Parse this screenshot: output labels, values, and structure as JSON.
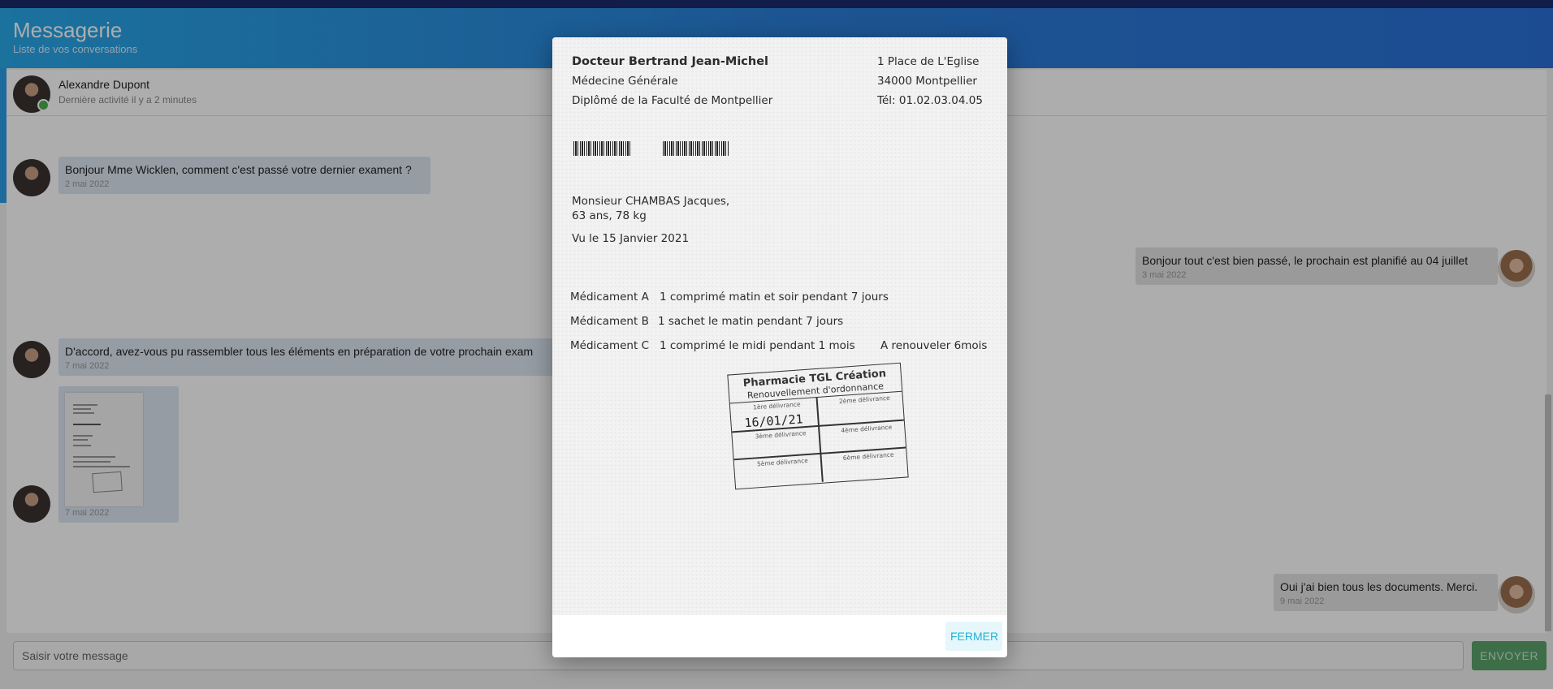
{
  "header": {
    "title": "Messagerie",
    "subtitle": "Liste de vos conversations"
  },
  "conversation": {
    "contact_name": "Alexandre Dupont",
    "status": "Dernière activité il y a 2 minutes"
  },
  "messages": [
    {
      "direction": "in",
      "text": "Bonjour Mme Wicklen, comment c'est passé votre dernier exament ?",
      "date": "2 mai 2022"
    },
    {
      "direction": "out",
      "text": "Bonjour tout c'est bien passé, le prochain est planifié au 04 juillet",
      "date": "3 mai 2022"
    },
    {
      "direction": "in",
      "text": "D'accord, avez-vous pu rassembler tous les éléments en préparation de votre prochain exam",
      "date": "7 mai 2022"
    },
    {
      "direction": "in",
      "attachment": "prescription-thumbnail",
      "date": "7 mai 2022"
    },
    {
      "direction": "out",
      "text": "Oui j'ai bien tous les documents. Merci.",
      "date": "9 mai 2022"
    }
  ],
  "composer": {
    "placeholder": "Saisir votre message",
    "send_label": "ENVOYER"
  },
  "modal": {
    "close_label": "FERMER",
    "prescription": {
      "doctor": "Docteur Bertrand Jean-Michel",
      "specialty": "Médecine Générale",
      "diploma": "Diplômé de la Faculté de Montpellier",
      "address1": "1 Place de L'Eglise",
      "address2": "34000 Montpellier",
      "phone": "Tél: 01.02.03.04.05",
      "patient_name": "Monsieur CHAMBAS Jacques,",
      "patient_info": "63 ans, 78 kg",
      "visit_date": "Vu le 15 Janvier 2021",
      "meds": [
        {
          "name": "Médicament A",
          "dosage": "1 comprimé matin et soir pendant 7 jours",
          "note": ""
        },
        {
          "name": "Médicament B",
          "dosage": "1 sachet le matin pendant 7 jours",
          "note": ""
        },
        {
          "name": "Médicament C",
          "dosage": "1 comprimé le midi pendant 1 mois",
          "note": "A renouveler 6mois"
        }
      ],
      "stamp": {
        "title": "Pharmacie TGL Création",
        "subtitle": "Renouvellement d'ordonnance",
        "cells": [
          "1ère délivrance",
          "2ème délivrance",
          "3ème délivrance",
          "4ème délivrance",
          "5ème délivrance",
          "6ème délivrance"
        ],
        "first_date": "16/01/21"
      }
    }
  }
}
